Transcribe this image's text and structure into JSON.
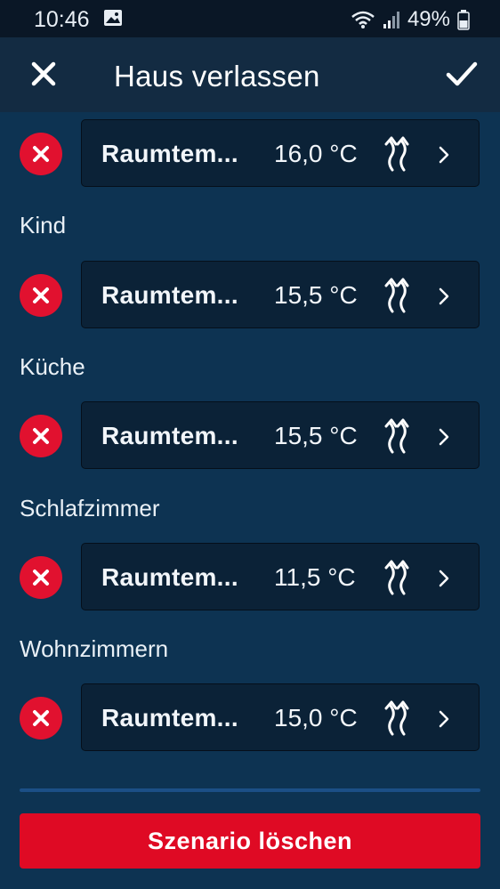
{
  "status_bar": {
    "time": "10:46",
    "battery": "49%"
  },
  "header": {
    "title": "Haus verlassen"
  },
  "entries": [
    {
      "room": "",
      "label": "Raumtem...",
      "temp": "16,0 °C"
    },
    {
      "room": "Kind",
      "label": "Raumtem...",
      "temp": "15,5 °C"
    },
    {
      "room": "Küche",
      "label": "Raumtem...",
      "temp": "15,5 °C"
    },
    {
      "room": "Schlafzimmer",
      "label": "Raumtem...",
      "temp": "11,5 °C"
    },
    {
      "room": "Wohnzimmern",
      "label": "Raumtem...",
      "temp": "15,0 °C"
    }
  ],
  "footer": {
    "delete_label": "Szenario löschen"
  },
  "colors": {
    "background": "#0d3352",
    "appbar": "#132b42",
    "card": "#0b2237",
    "danger": "#e1112f"
  },
  "icons": {
    "close": "close-icon",
    "confirm": "check-icon",
    "remove": "remove-icon",
    "heating": "heating-icon",
    "chevron": "chevron-right-icon"
  }
}
